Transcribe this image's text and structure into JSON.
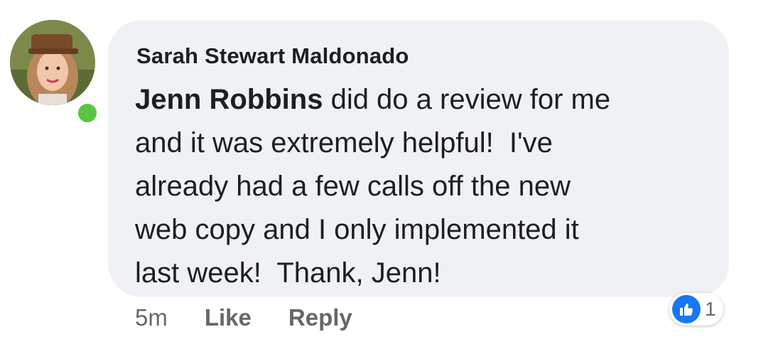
{
  "comment": {
    "author": "Sarah Stewart Maldonado",
    "mention": "Jenn Robbins",
    "text_after_mention": " did do a review for me\nand it was extremely helpful!  I've\nalready had a few calls off the new\nweb copy and I only implemented it\nlast week!  Thank, Jenn!",
    "timestamp": "5m",
    "like_label": "Like",
    "reply_label": "Reply",
    "reaction_count": "1",
    "reaction_icon": "thumbs-up-icon"
  },
  "avatar": {
    "online": true,
    "status_color": "#5bc243"
  },
  "colors": {
    "bubble": "#eff1f5",
    "text": "#1c1e21",
    "meta": "#65676b",
    "like_blue": "#1877f2"
  }
}
